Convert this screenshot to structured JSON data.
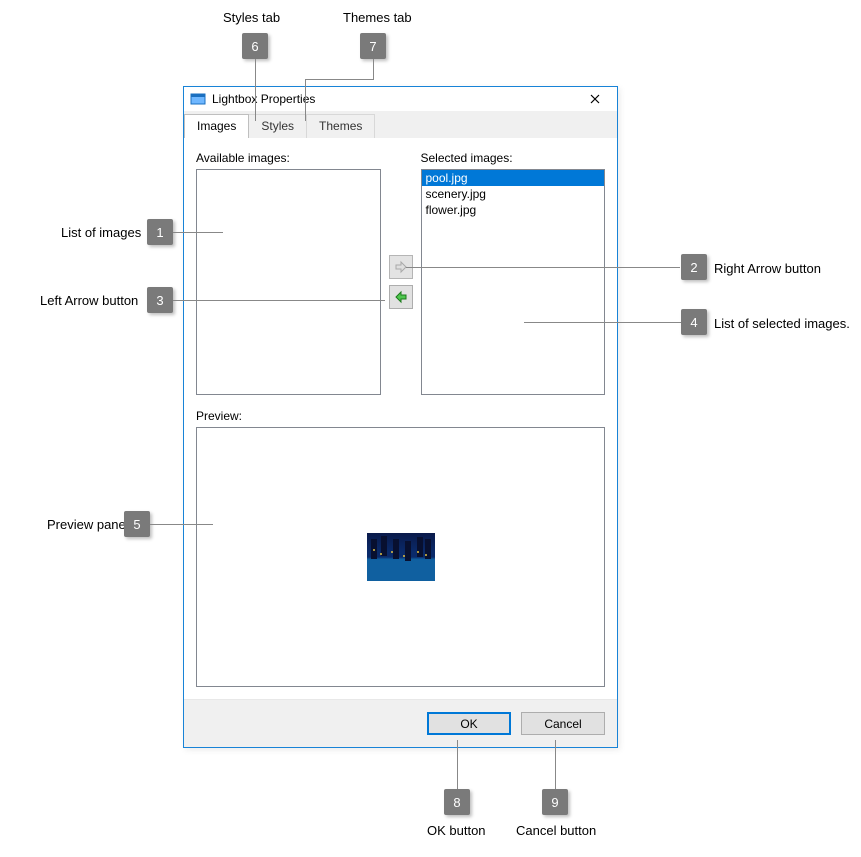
{
  "window": {
    "title": "Lightbox Properties"
  },
  "tabs": [
    {
      "label": "Images",
      "active": true
    },
    {
      "label": "Styles",
      "active": false
    },
    {
      "label": "Themes",
      "active": false
    }
  ],
  "labels": {
    "available": "Available images:",
    "selected": "Selected images:",
    "preview": "Preview:"
  },
  "available_images": [],
  "selected_images": [
    {
      "name": "pool.jpg",
      "selected": true
    },
    {
      "name": "scenery.jpg",
      "selected": false
    },
    {
      "name": "flower.jpg",
      "selected": false
    }
  ],
  "buttons": {
    "ok": "OK",
    "cancel": "Cancel"
  },
  "callouts": {
    "1": "List of images",
    "2": "Right Arrow button",
    "3": "Left Arrow  button",
    "4": "List of selected images.",
    "5": "Preview pane",
    "6": "Styles tab",
    "7": "Themes tab",
    "8": "OK button",
    "9": "Cancel button"
  }
}
